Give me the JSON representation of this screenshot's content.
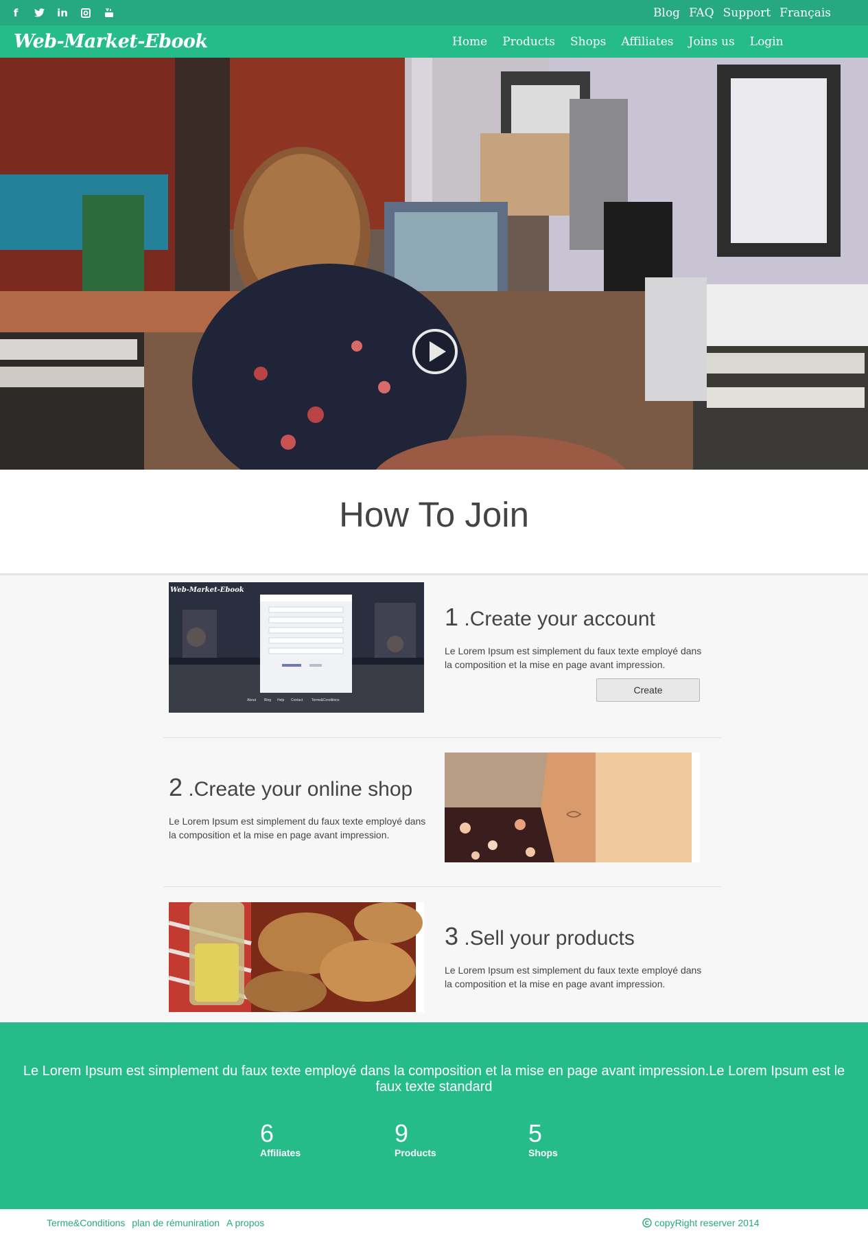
{
  "top_bar": {
    "social": [
      {
        "name": "facebook-icon",
        "glyph": "f"
      },
      {
        "name": "twitter-icon",
        "glyph": "t"
      },
      {
        "name": "linkedin-icon",
        "glyph": "in"
      },
      {
        "name": "instagram-icon",
        "glyph": "◘"
      },
      {
        "name": "youtube-icon",
        "glyph": "▶"
      }
    ],
    "links": [
      "Blog",
      "FAQ",
      "Support",
      "Français"
    ]
  },
  "nav": {
    "logo": "Web-Market-Ebook",
    "items": [
      "Home",
      "Products",
      "Shops",
      "Affiliates",
      "Joins us",
      "Login"
    ]
  },
  "hero": {
    "play_icon": "play-circle-icon"
  },
  "section_title": "How To Join",
  "steps": [
    {
      "number": "1",
      "title": ".Create your account",
      "text": "Le Lorem Ipsum est simplement du faux texte employé dans la composition et la mise en page avant impression.",
      "button": "Create"
    },
    {
      "number": "2",
      "title": ".Create your online shop",
      "text": "Le Lorem Ipsum est simplement du faux texte employé dans la composition et la mise en page avant impression."
    },
    {
      "number": "3",
      "title": ".Sell your products",
      "text": "Le Lorem Ipsum est simplement du faux texte employé dans la composition et la mise en page avant impression."
    }
  ],
  "step1_screenshot": {
    "logo": "Web-Market-Ebook",
    "footer_links": [
      "About",
      "Blog",
      "Help",
      "Contact",
      "Terms&Conditions"
    ]
  },
  "banner": {
    "text": "Le Lorem Ipsum est simplement du faux texte employé dans la composition et la mise en page avant impression.Le Lorem Ipsum est le faux texte standard",
    "stats": [
      {
        "value": "6",
        "label": "Affiliates"
      },
      {
        "value": "9",
        "label": "Products"
      },
      {
        "value": "5",
        "label": "Shops"
      }
    ]
  },
  "footer": {
    "links": [
      "Terme&Conditions",
      "plan de rémuniration",
      "A propos"
    ],
    "copyright": "copyRight reserver 2014",
    "copyright_icon": "copyright-icon"
  },
  "colors": {
    "accent": "#26bc8a",
    "top_bar": "#26a881",
    "link": "#26a881"
  }
}
